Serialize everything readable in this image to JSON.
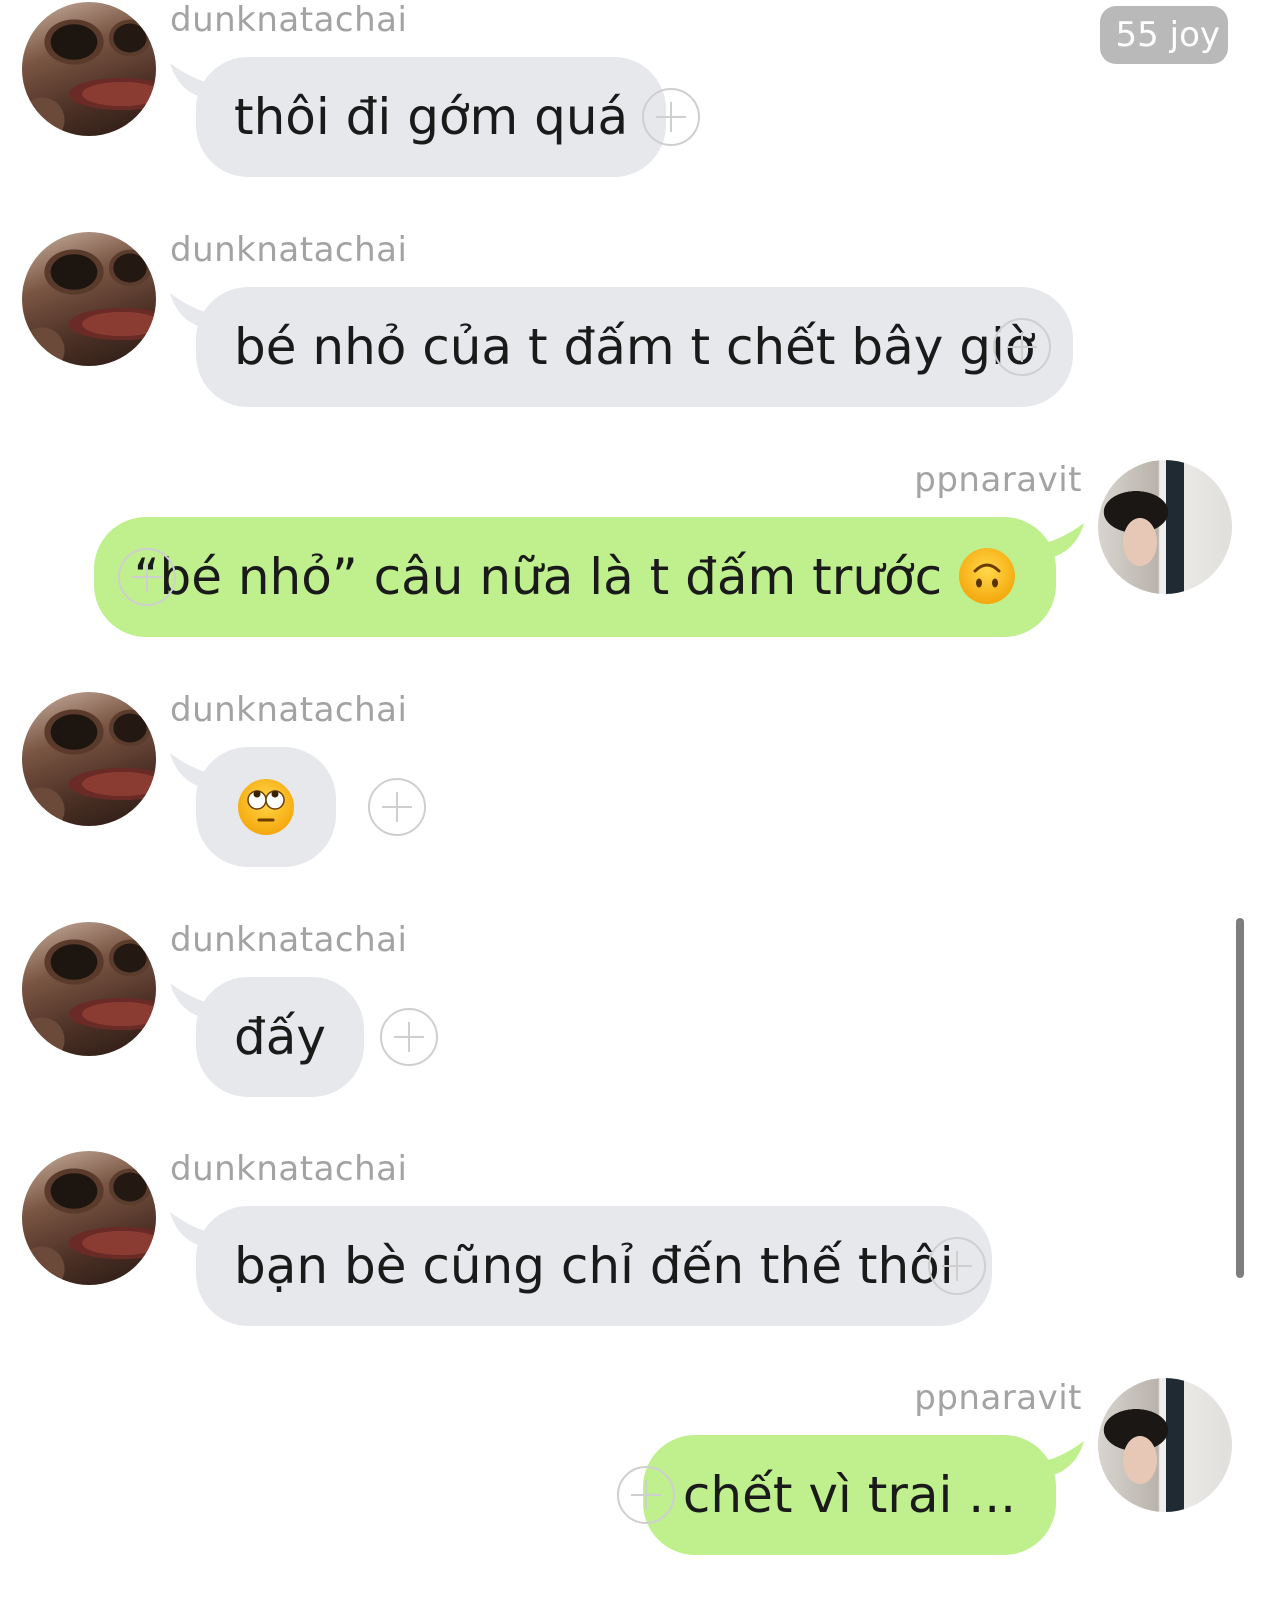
{
  "badge": "55 joy",
  "messages": [
    {
      "sender": "dunknatachai",
      "text": "thôi đi gớm quá"
    },
    {
      "sender": "dunknatachai",
      "text": "bé nhỏ của t đấm t chết bây giờ"
    },
    {
      "sender": "ppnaravit",
      "text": "“bé nhỏ” câu nữa là t đấm trước",
      "emoji": "upside-down-face"
    },
    {
      "sender": "dunknatachai",
      "emoji": "eye-roll-face"
    },
    {
      "sender": "dunknatachai",
      "text": "đấy"
    },
    {
      "sender": "dunknatachai",
      "text": "bạn bè cũng chỉ đến thế thôi"
    },
    {
      "sender": "ppnaravit",
      "text": "chết vì trai ..."
    }
  ],
  "colors": {
    "incoming_bubble": "#e6e8ec",
    "outgoing_bubble": "#bff08d",
    "sender_name": "#a3a3a3",
    "badge_bg": "#b9b9b9"
  },
  "icons": {
    "add_reaction": "plus-circle-icon"
  }
}
